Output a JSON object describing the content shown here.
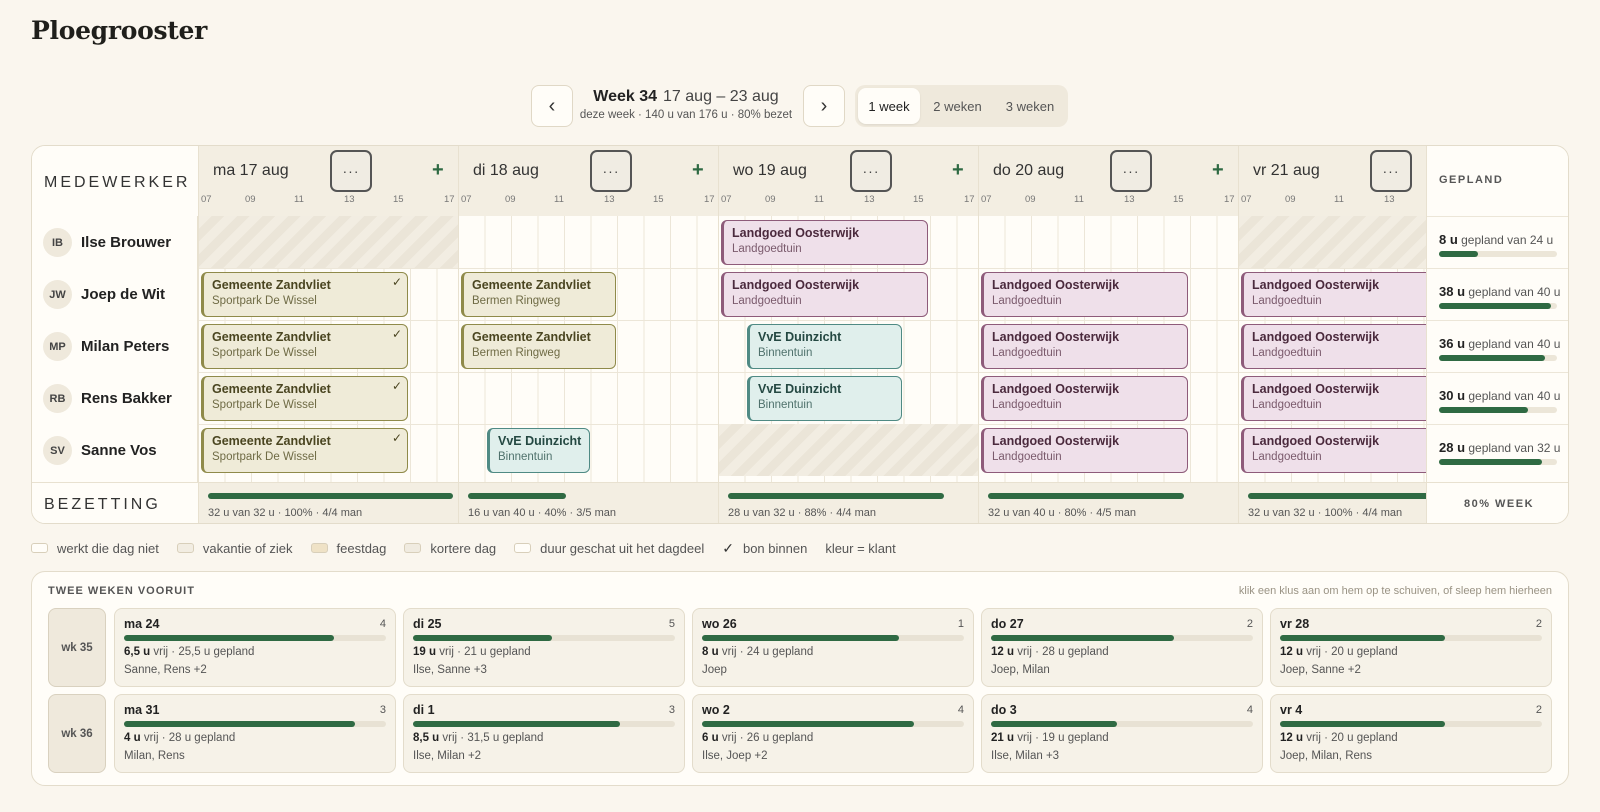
{
  "page_title": "Ploegrooster",
  "nav": {
    "prev_label": "‹",
    "next_label": "›",
    "week_label": "Week 34",
    "range": "17 aug – 23 aug",
    "summary": "deze week · 140 u van 176 u · 80% bezet"
  },
  "views": [
    "1 week",
    "2 weken",
    "3 weken"
  ],
  "grid": {
    "employee_header": "MEDEWERKER",
    "planned_header": "GEPLAND",
    "occupancy_label": "BEZETTING",
    "more_label": "···",
    "add_label": "+",
    "ticks": [
      "07",
      "09",
      "11",
      "13",
      "15",
      "17"
    ],
    "employees": [
      {
        "initials": "IB",
        "name": "Ilse Brouwer",
        "hours": "8 u",
        "planned": "gepland van 24 u",
        "fill": 0.33
      },
      {
        "initials": "JW",
        "name": "Joep de Wit",
        "hours": "38 u",
        "planned": "gepland van 40 u",
        "fill": 0.95
      },
      {
        "initials": "MP",
        "name": "Milan Peters",
        "hours": "36 u",
        "planned": "gepland van 40 u",
        "fill": 0.9
      },
      {
        "initials": "RB",
        "name": "Rens Bakker",
        "hours": "30 u",
        "planned": "gepland van 40 u",
        "fill": 0.75
      },
      {
        "initials": "SV",
        "name": "Sanne Vos",
        "hours": "28 u",
        "planned": "gepland van 32 u",
        "fill": 0.875
      }
    ],
    "week_total": "80% WEEK",
    "days": [
      {
        "label": "ma 17 aug",
        "occupancy": "32 u van 32 u · 100% · 4/4 man",
        "fill": 1.0,
        "jobs": [
          {
            "client": "Gemeente Zandvliet",
            "location": "Sportpark De Wissel",
            "color": "g",
            "check": "✓"
          },
          {
            "client": "Gemeente Zandvliet",
            "location": "Sportpark De Wissel",
            "color": "g",
            "check": "✓"
          },
          {
            "client": "Gemeente Zandvliet",
            "location": "Sportpark De Wissel",
            "color": "g",
            "check": "✓"
          },
          {
            "client": "Gemeente Zandvliet",
            "location": "Sportpark De Wissel",
            "color": "g",
            "check": "✓"
          }
        ]
      },
      {
        "label": "di 18 aug",
        "occupancy": "16 u van 40 u · 40% · 3/5 man",
        "fill": 0.4,
        "jobs": [
          {
            "client": "Gemeente Zandvliet",
            "location": "Bermen Ringweg",
            "color": "g"
          },
          {
            "client": "Gemeente Zandvliet",
            "location": "Bermen Ringweg",
            "color": "g"
          },
          {
            "client": "VvE Duinzicht",
            "location": "Binnentuin",
            "color": "t"
          }
        ]
      },
      {
        "label": "wo 19 aug",
        "occupancy": "28 u van 32 u · 88% · 4/4 man",
        "fill": 0.88,
        "jobs": [
          {
            "client": "Landgoed Oosterwijk",
            "location": "Landgoedtuin",
            "color": "p"
          },
          {
            "client": "Landgoed Oosterwijk",
            "location": "Landgoedtuin",
            "color": "p"
          },
          {
            "client": "VvE Duinzicht",
            "location": "Binnentuin",
            "color": "t"
          },
          {
            "client": "VvE Duinzicht",
            "location": "Binnentuin",
            "color": "t"
          }
        ]
      },
      {
        "label": "do 20 aug",
        "occupancy": "32 u van 40 u · 80% · 4/5 man",
        "fill": 0.8,
        "jobs": [
          {
            "client": "Landgoed Oosterwijk",
            "location": "Landgoedtuin",
            "color": "p"
          },
          {
            "client": "Landgoed Oosterwijk",
            "location": "Landgoedtuin",
            "color": "p"
          },
          {
            "client": "Landgoed Oosterwijk",
            "location": "Landgoedtuin",
            "color": "p"
          },
          {
            "client": "Landgoed Oosterwijk",
            "location": "Landgoedtuin",
            "color": "p"
          }
        ]
      },
      {
        "label": "vr 21 aug",
        "occupancy": "32 u van 32 u · 100% · 4/4 man",
        "fill": 1.0,
        "jobs": [
          {
            "client": "Landgoed Oosterwijk",
            "location": "Landgoedtuin",
            "color": "p"
          },
          {
            "client": "Landgoed Oosterwijk",
            "location": "Landgoedtuin",
            "color": "p"
          },
          {
            "client": "Landgoed Oosterwijk",
            "location": "Landgoedtuin",
            "color": "p"
          },
          {
            "client": "Landgoed Oosterwijk",
            "location": "Landgoedtuin",
            "color": "p"
          }
        ]
      }
    ]
  },
  "legend": [
    {
      "label": "werkt die dag niet",
      "swatch": "#fffdf8"
    },
    {
      "label": "vakantie of ziek",
      "swatch": "#f2ede2"
    },
    {
      "label": "feestdag",
      "swatch": "#efe2c6"
    },
    {
      "label": "kortere dag",
      "swatch": "#f0ebe0"
    },
    {
      "label": "duur geschat uit het dagdeel",
      "swatch": "#fffdf8"
    },
    {
      "label": "bon binnen",
      "check": "✓"
    },
    {
      "label": "kleur = klant"
    }
  ],
  "ahead": {
    "title": "TWEE WEKEN VOORUIT",
    "hint": "klik een klus aan om hem op te schuiven, of sleep hem hierheen",
    "weeks": [
      {
        "label": "wk 35",
        "days": [
          {
            "day": "ma 24",
            "count": "4",
            "free": "6,5 u",
            "rest": "vrij · 25,5 u gepland",
            "people": "Sanne, Rens +2",
            "fill": 0.8
          },
          {
            "day": "di 25",
            "count": "5",
            "free": "19 u",
            "rest": "vrij · 21 u gepland",
            "people": "Ilse, Sanne +3",
            "fill": 0.53
          },
          {
            "day": "wo 26",
            "count": "1",
            "free": "8 u",
            "rest": "vrij · 24 u gepland",
            "people": "Joep",
            "fill": 0.75
          },
          {
            "day": "do 27",
            "count": "2",
            "free": "12 u",
            "rest": "vrij · 28 u gepland",
            "people": "Joep, Milan",
            "fill": 0.7
          },
          {
            "day": "vr 28",
            "count": "2",
            "free": "12 u",
            "rest": "vrij · 20 u gepland",
            "people": "Joep, Sanne +2",
            "fill": 0.63
          }
        ]
      },
      {
        "label": "wk 36",
        "days": [
          {
            "day": "ma 31",
            "count": "3",
            "free": "4 u",
            "rest": "vrij · 28 u gepland",
            "people": "Milan, Rens",
            "fill": 0.88
          },
          {
            "day": "di 1",
            "count": "3",
            "free": "8,5 u",
            "rest": "vrij · 31,5 u gepland",
            "people": "Ilse, Milan +2",
            "fill": 0.79
          },
          {
            "day": "wo 2",
            "count": "4",
            "free": "6 u",
            "rest": "vrij · 26 u gepland",
            "people": "Ilse, Joep +2",
            "fill": 0.81
          },
          {
            "day": "do 3",
            "count": "4",
            "free": "21 u",
            "rest": "vrij · 19 u gepland",
            "people": "Ilse, Milan +3",
            "fill": 0.48
          },
          {
            "day": "vr 4",
            "count": "2",
            "free": "12 u",
            "rest": "vrij · 20 u gepland",
            "people": "Joep, Milan, Rens",
            "fill": 0.63
          }
        ]
      }
    ]
  }
}
